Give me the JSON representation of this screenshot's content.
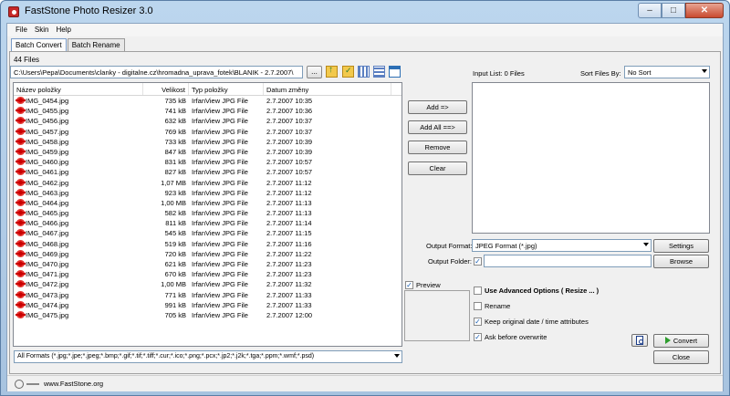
{
  "window": {
    "title": "FastStone Photo Resizer 3.0"
  },
  "menu": [
    "File",
    "Skin",
    "Help"
  ],
  "tabs": [
    "Batch Convert",
    "Batch Rename"
  ],
  "files_count": "44 Files",
  "path": "C:\\Users\\Pepa\\Documents\\clanky - digitalne.cz\\hromadna_uprava_fotek\\BLANIK - 2.7.2007\\",
  "browse_label": "...",
  "columns": {
    "name": "Název položky",
    "size": "Velikost",
    "type": "Typ položky",
    "date": "Datum změny"
  },
  "files": [
    {
      "name": "IMG_0454.jpg",
      "size": "735 kB",
      "type": "IrfanView JPG File",
      "date": "2.7.2007 10:35"
    },
    {
      "name": "IMG_0455.jpg",
      "size": "741 kB",
      "type": "IrfanView JPG File",
      "date": "2.7.2007 10:36"
    },
    {
      "name": "IMG_0456.jpg",
      "size": "632 kB",
      "type": "IrfanView JPG File",
      "date": "2.7.2007 10:37"
    },
    {
      "name": "IMG_0457.jpg",
      "size": "769 kB",
      "type": "IrfanView JPG File",
      "date": "2.7.2007 10:37"
    },
    {
      "name": "IMG_0458.jpg",
      "size": "733 kB",
      "type": "IrfanView JPG File",
      "date": "2.7.2007 10:39"
    },
    {
      "name": "IMG_0459.jpg",
      "size": "847 kB",
      "type": "IrfanView JPG File",
      "date": "2.7.2007 10:39"
    },
    {
      "name": "IMG_0460.jpg",
      "size": "831 kB",
      "type": "IrfanView JPG File",
      "date": "2.7.2007 10:57"
    },
    {
      "name": "IMG_0461.jpg",
      "size": "827 kB",
      "type": "IrfanView JPG File",
      "date": "2.7.2007 10:57"
    },
    {
      "name": "IMG_0462.jpg",
      "size": "1,07 MB",
      "type": "IrfanView JPG File",
      "date": "2.7.2007 11:12"
    },
    {
      "name": "IMG_0463.jpg",
      "size": "923 kB",
      "type": "IrfanView JPG File",
      "date": "2.7.2007 11:12"
    },
    {
      "name": "IMG_0464.jpg",
      "size": "1,00 MB",
      "type": "IrfanView JPG File",
      "date": "2.7.2007 11:13"
    },
    {
      "name": "IMG_0465.jpg",
      "size": "582 kB",
      "type": "IrfanView JPG File",
      "date": "2.7.2007 11:13"
    },
    {
      "name": "IMG_0466.jpg",
      "size": "811 kB",
      "type": "IrfanView JPG File",
      "date": "2.7.2007 11:14"
    },
    {
      "name": "IMG_0467.jpg",
      "size": "545 kB",
      "type": "IrfanView JPG File",
      "date": "2.7.2007 11:15"
    },
    {
      "name": "IMG_0468.jpg",
      "size": "519 kB",
      "type": "IrfanView JPG File",
      "date": "2.7.2007 11:16"
    },
    {
      "name": "IMG_0469.jpg",
      "size": "720 kB",
      "type": "IrfanView JPG File",
      "date": "2.7.2007 11:22"
    },
    {
      "name": "IMG_0470.jpg",
      "size": "621 kB",
      "type": "IrfanView JPG File",
      "date": "2.7.2007 11:23"
    },
    {
      "name": "IMG_0471.jpg",
      "size": "670 kB",
      "type": "IrfanView JPG File",
      "date": "2.7.2007 11:23"
    },
    {
      "name": "IMG_0472.jpg",
      "size": "1,00 MB",
      "type": "IrfanView JPG File",
      "date": "2.7.2007 11:32"
    },
    {
      "name": "IMG_0473.jpg",
      "size": "771 kB",
      "type": "IrfanView JPG File",
      "date": "2.7.2007 11:33"
    },
    {
      "name": "IMG_0474.jpg",
      "size": "991 kB",
      "type": "IrfanView JPG File",
      "date": "2.7.2007 11:33"
    },
    {
      "name": "IMG_0475.jpg",
      "size": "705 kB",
      "type": "IrfanView JPG File",
      "date": "2.7.2007 12:00"
    }
  ],
  "format_filter": "All Formats (*.jpg;*.jpe;*.jpeg;*.bmp;*.gif;*.tif;*.tiff;*.cur;*.ico;*.png;*.pcx;*.jp2;*.j2k;*.tga;*.ppm;*.wmf;*.psd)",
  "buttons": {
    "add": "Add =>",
    "add_all": "Add All ==>",
    "remove": "Remove",
    "clear": "Clear",
    "settings": "Settings",
    "browse": "Browse",
    "convert": "Convert",
    "close": "Close"
  },
  "input_list_label": "Input List:  0 Files",
  "sort_label": "Sort Files By:",
  "sort_value": "No Sort",
  "output_format_label": "Output Format:",
  "output_format_value": "JPEG Format (*.jpg)",
  "output_folder_label": "Output Folder:",
  "output_folder_checked": true,
  "output_folder_value": "",
  "preview": {
    "label": "Preview",
    "checked": true
  },
  "options": {
    "advanced": {
      "label": "Use Advanced Options ( Resize ... )",
      "checked": false
    },
    "rename": {
      "label": "Rename",
      "checked": false
    },
    "keep_date": {
      "label": "Keep original date / time attributes",
      "checked": true
    },
    "ask_overwrite": {
      "label": "Ask before overwrite",
      "checked": true
    }
  },
  "status_text": "www.FastStone.org",
  "icons": [
    "app-icon",
    "up-folder-icon",
    "favorites-icon",
    "thumbnails-view-icon",
    "list-view-icon",
    "details-view-icon",
    "preview-document-icon",
    "convert-arrow-icon",
    "faststone-logo-icon"
  ]
}
